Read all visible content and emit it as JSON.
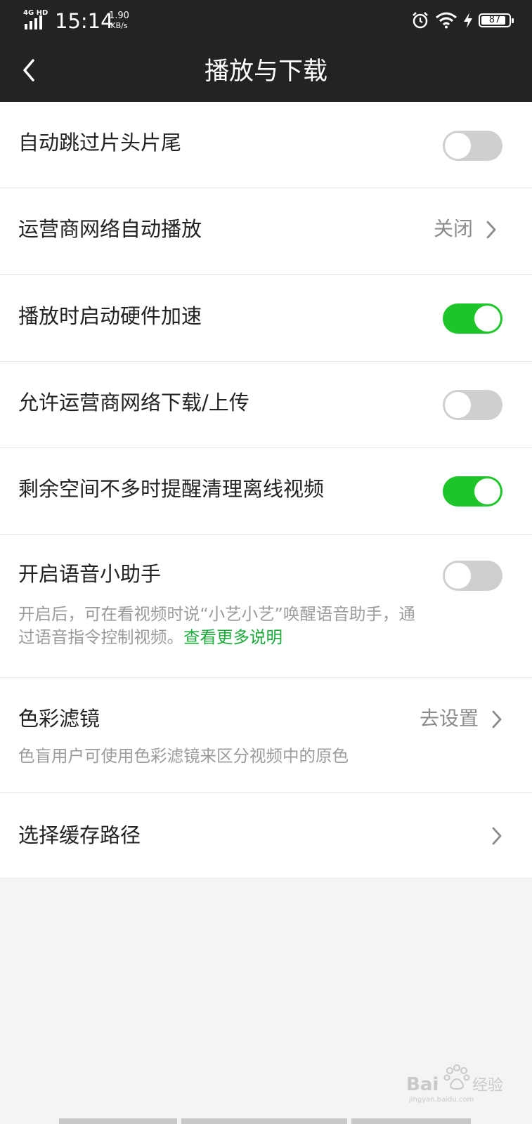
{
  "status_bar": {
    "network": "4G HD",
    "time": "15:14",
    "speed_value": "1.90",
    "speed_unit": "KB/s",
    "battery": "87",
    "icons": [
      "alarm-icon",
      "wifi-icon",
      "charging-icon",
      "battery-icon"
    ]
  },
  "nav": {
    "title": "播放与下载",
    "back_icon": "chevron-left-icon"
  },
  "settings": [
    {
      "label": "自动跳过片头片尾",
      "control": "toggle",
      "on": false
    },
    {
      "label": "运营商网络自动播放",
      "control": "value",
      "value": "关闭"
    },
    {
      "label": "播放时启动硬件加速",
      "control": "toggle",
      "on": true
    },
    {
      "label": "允许运营商网络下载/上传",
      "control": "toggle",
      "on": false
    },
    {
      "label": "剩余空间不多时提醒清理离线视频",
      "control": "toggle",
      "on": true
    },
    {
      "label": "开启语音小助手",
      "control": "toggle",
      "on": false,
      "desc_line1": "开启后，可在看视频时说“小艺小艺”唤醒语音助手，通",
      "desc_line2": "过语音指令控制视频。",
      "desc_link": "查看更多说明"
    },
    {
      "label": "色彩滤镜",
      "control": "value",
      "value": "去设置",
      "desc_line1": "色盲用户可使用色彩滤镜来区分视频中的原色"
    },
    {
      "label": "选择缓存路径",
      "control": "chevron"
    }
  ],
  "colors": {
    "header_bg": "#232323",
    "toggle_on": "#1ec52a",
    "toggle_off": "#cfcfcf",
    "link": "#1ba93a"
  },
  "watermark": {
    "text": "Bai经验",
    "sub": "jingyan.baidu.com"
  }
}
